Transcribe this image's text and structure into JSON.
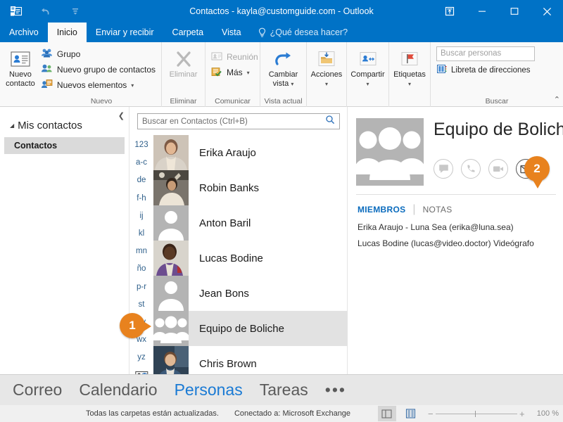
{
  "window": {
    "title": "Contactos - kayla@customguide.com - Outlook",
    "quick_access": [
      {
        "name": "outlook-icon",
        "label": ""
      },
      {
        "name": "undo-icon",
        "label": ""
      },
      {
        "name": "customize-qat-icon",
        "label": ""
      }
    ],
    "controls": [
      {
        "name": "ribbon-display-options",
        "glyph": "⍐"
      },
      {
        "name": "minimize",
        "glyph": "—"
      },
      {
        "name": "maximize",
        "glyph": "□"
      },
      {
        "name": "close",
        "glyph": "✕"
      }
    ]
  },
  "tabs": [
    {
      "label": "Archivo",
      "active": false
    },
    {
      "label": "Inicio",
      "active": true
    },
    {
      "label": "Enviar y recibir",
      "active": false
    },
    {
      "label": "Carpeta",
      "active": false
    },
    {
      "label": "Vista",
      "active": false
    }
  ],
  "tell_me": {
    "label": "¿Qué desea hacer?",
    "icon": "lightbulb-icon"
  },
  "ribbon": {
    "groups": [
      {
        "name": "nuevo",
        "title": "Nuevo",
        "big": {
          "label_line1": "Nuevo",
          "label_line2": "contacto",
          "icon": "new-contact-icon"
        },
        "small": [
          {
            "label": "Grupo",
            "icon": "group-icon",
            "caret": false,
            "disabled": false
          },
          {
            "label": "Nuevo grupo de contactos",
            "icon": "contact-group-icon",
            "caret": false,
            "disabled": false
          },
          {
            "label": "Nuevos elementos",
            "icon": "new-items-icon",
            "caret": true,
            "disabled": false
          }
        ]
      },
      {
        "name": "eliminar",
        "title": "Eliminar",
        "big": {
          "label_line1": "Eliminar",
          "label_line2": "",
          "icon": "delete-x-icon",
          "disabled": true
        }
      },
      {
        "name": "comunicar",
        "title": "Comunicar",
        "small": [
          {
            "label": "Reunión",
            "icon": "meeting-icon",
            "caret": false,
            "disabled": true
          },
          {
            "label": "Más",
            "icon": "more-icon",
            "caret": true,
            "disabled": false
          }
        ]
      },
      {
        "name": "vista-actual",
        "title": "Vista actual",
        "big": {
          "label_line1": "Cambiar",
          "label_line2": "vista",
          "icon": "change-view-icon",
          "caret": true
        }
      },
      {
        "name": "acciones",
        "title": "",
        "big": {
          "label_line1": "Acciones",
          "label_line2": "",
          "icon": "actions-folder-icon",
          "caret": true
        }
      },
      {
        "name": "compartir",
        "title": "",
        "big": {
          "label_line1": "Compartir",
          "label_line2": "",
          "icon": "share-contact-icon",
          "caret": true
        }
      },
      {
        "name": "etiquetas",
        "title": "",
        "big": {
          "label_line1": "Etiquetas",
          "label_line2": "",
          "icon": "flag-icon",
          "caret": true
        }
      },
      {
        "name": "buscar",
        "title": "Buscar",
        "search_placeholder": "Buscar personas",
        "address_book": {
          "label": "Libreta de direcciones",
          "icon": "address-book-icon"
        }
      }
    ],
    "collapse_icon": "chevron-up-icon"
  },
  "folder_pane": {
    "collapse_icon": "chevron-left-icon",
    "header": "Mis contactos",
    "items": [
      {
        "label": "Contactos",
        "selected": true
      }
    ]
  },
  "list_pane": {
    "search_placeholder": "Buscar en Contactos (Ctrl+B)",
    "search_icon": "search-icon",
    "alpha_index": [
      "123",
      "a-c",
      "de",
      "f-h",
      "ij",
      "kl",
      "mn",
      "ño",
      "p-r",
      "st",
      "uv",
      "wx",
      "yz"
    ],
    "global_address_icon": "global-address-list-icon",
    "contacts": [
      {
        "name": "Erika Araujo",
        "avatar": "photo",
        "selected": false
      },
      {
        "name": "Robin Banks",
        "avatar": "photo",
        "selected": false
      },
      {
        "name": "Anton Baril",
        "avatar": "silhouette",
        "selected": false
      },
      {
        "name": "Lucas Bodine",
        "avatar": "photo",
        "selected": false
      },
      {
        "name": "Jean Bons",
        "avatar": "silhouette",
        "selected": false
      },
      {
        "name": "Equipo de Boliche",
        "avatar": "group-silhouette",
        "selected": true
      },
      {
        "name": "Chris Brown",
        "avatar": "photo",
        "selected": false
      }
    ]
  },
  "reading_pane": {
    "contact_name": "Equipo de Boliche",
    "avatar": "group-silhouette",
    "actions": [
      {
        "name": "chat-icon",
        "enabled": false
      },
      {
        "name": "phone-icon",
        "enabled": false
      },
      {
        "name": "video-icon",
        "enabled": false
      },
      {
        "name": "email-icon",
        "enabled": true
      }
    ],
    "tabs": [
      {
        "label": "MIEMBROS",
        "active": true
      },
      {
        "label": "NOTAS",
        "active": false
      }
    ],
    "members": [
      "Erika Araujo - Luna Sea (erika@luna.sea)",
      "Lucas Bodine (lucas@video.doctor) Videógrafo"
    ]
  },
  "nav_bar": {
    "items": [
      {
        "label": "Correo",
        "active": false
      },
      {
        "label": "Calendario",
        "active": false
      },
      {
        "label": "Personas",
        "active": true
      },
      {
        "label": "Tareas",
        "active": false
      }
    ],
    "more": "•••"
  },
  "status_bar": {
    "sync_status": "Todas las carpetas están actualizadas.",
    "connection": "Conectado a: Microsoft Exchange",
    "view_buttons": [
      {
        "name": "reading-view-button",
        "active": true
      },
      {
        "name": "normal-view-button",
        "active": false
      }
    ],
    "zoom": {
      "minus": "−",
      "plus": "+",
      "label": "100 %"
    }
  },
  "callouts": [
    {
      "number": "1",
      "target": "contact-row-equipo-de-boliche"
    },
    {
      "number": "2",
      "target": "email-action-button"
    }
  ],
  "colors": {
    "titlebar": "#0072c6",
    "accent_blue": "#1a7ad4",
    "callout_orange": "#e8821e",
    "selected_row": "#e2e2e2"
  }
}
